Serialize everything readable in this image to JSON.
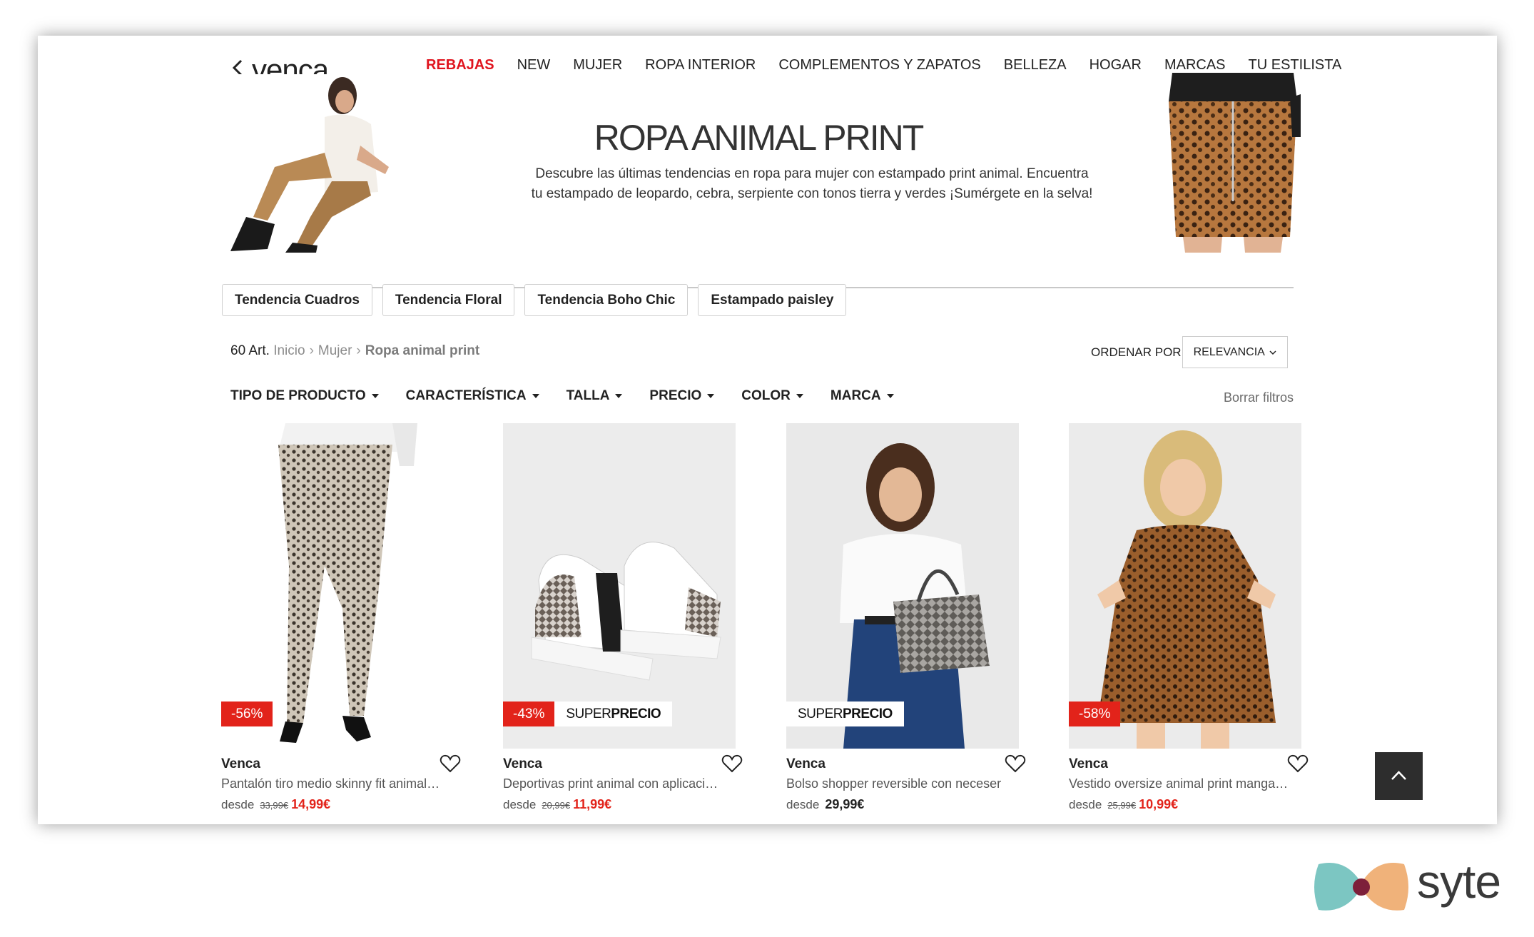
{
  "nav": {
    "logo": "venca",
    "links": [
      "REBAJAS",
      "NEW",
      "MUJER",
      "ROPA INTERIOR",
      "COMPLEMENTOS Y ZAPATOS",
      "BELLEZA",
      "HOGAR",
      "MARCAS",
      "TU ESTILISTA"
    ]
  },
  "hero": {
    "title": "ROPA ANIMAL PRINT",
    "description": "Descubre las últimas tendencias en ropa para mujer con estampado print animal. Encuentra tu estampado de leopardo, cebra, serpiente con tonos tierra y verdes ¡Sumérgete en la selva!"
  },
  "chips": [
    "Tendencia Cuadros",
    "Tendencia Floral",
    "Tendencia Boho Chic",
    "Estampado paisley"
  ],
  "listing": {
    "count": "60 Art.",
    "breadcrumb": [
      "Inicio",
      "Mujer",
      "Ropa animal print"
    ],
    "sort_label": "ORDENAR POR",
    "sort_value": "RELEVANCIA",
    "filters": [
      "TIPO DE PRODUCTO",
      "CARACTERÍSTICA",
      "TALLA",
      "PRECIO",
      "COLOR",
      "MARCA"
    ],
    "clear_filters": "Borrar filtros"
  },
  "products": [
    {
      "brand": "Venca",
      "name": "Pantalón tiro medio skinny fit animal print",
      "from": "desde",
      "old_price": "33,99€",
      "price": "14,99€",
      "discount": "-56%",
      "super": false
    },
    {
      "brand": "Venca",
      "name": "Deportivas print animal con aplicaciones",
      "from": "desde",
      "old_price": "20,99€",
      "price": "11,99€",
      "discount": "-43%",
      "super": true
    },
    {
      "brand": "Venca",
      "name": "Bolso shopper reversible con neceser",
      "from": "desde",
      "old_price": "",
      "price": "29,99€",
      "discount": "",
      "super": true
    },
    {
      "brand": "Venca",
      "name": "Vestido oversize animal print manga corta",
      "from": "desde",
      "old_price": "25,99€",
      "price": "10,99€",
      "discount": "-58%",
      "super": false
    }
  ],
  "badge_super": {
    "light": "SUPER",
    "bold": "PRECIO"
  },
  "watermark": "syte",
  "colors": {
    "accent_red": "#e2231a",
    "text_dark": "#222222",
    "muted": "#8b8b8b",
    "top_button": "#2d2d2d"
  },
  "icons": [
    "back-arrow-icon",
    "heart-icon",
    "chevron-up-icon",
    "caret-down-icon",
    "chevron-down-icon"
  ]
}
